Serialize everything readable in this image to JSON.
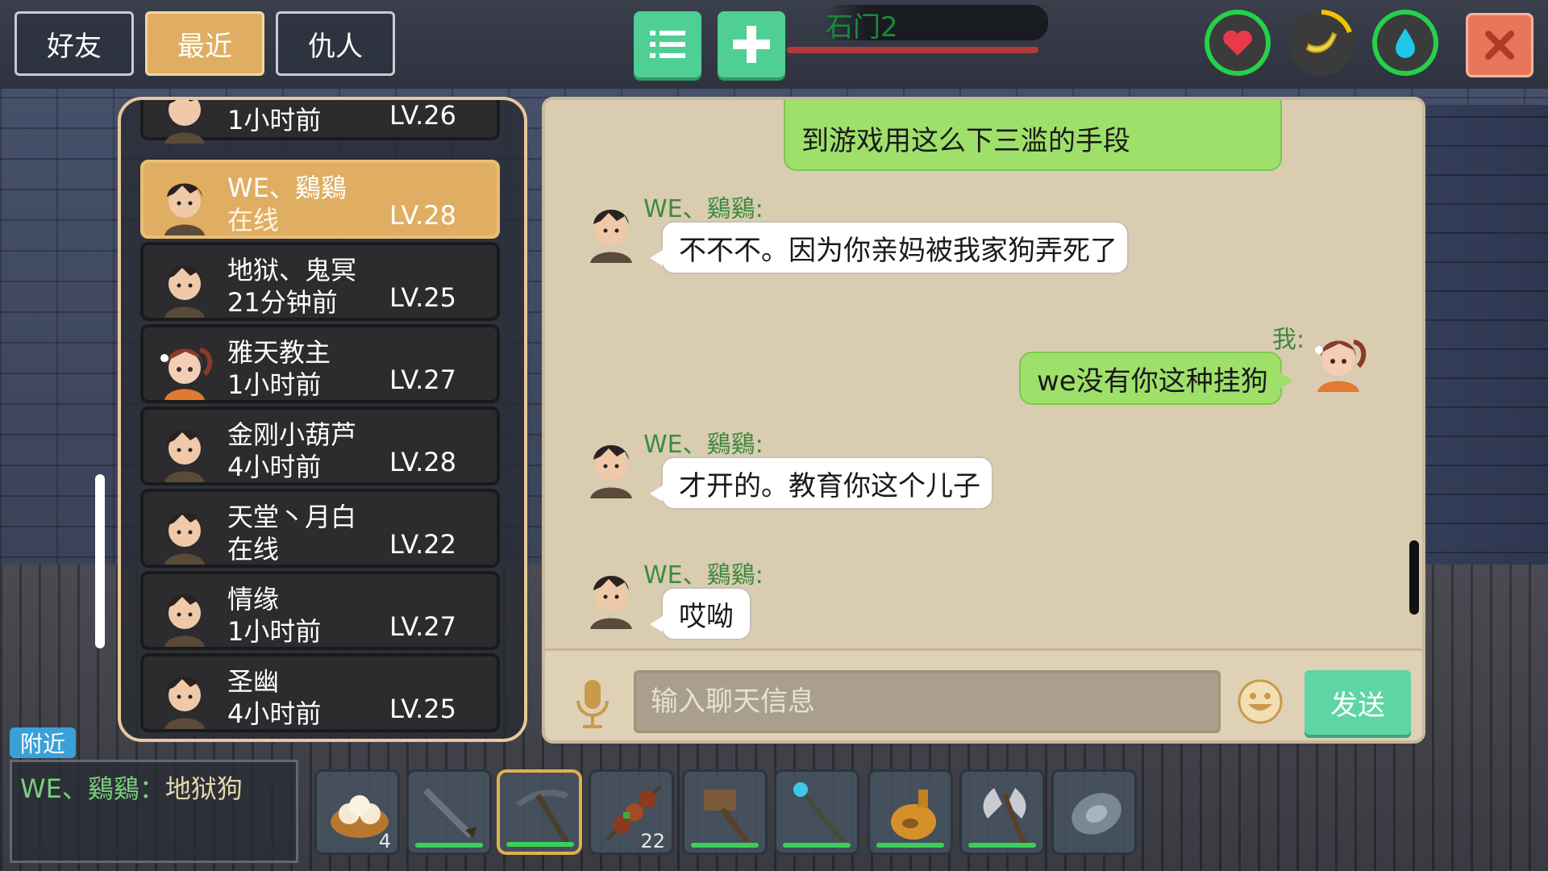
{
  "tabs": [
    {
      "label": "好友",
      "active": false
    },
    {
      "label": "最近",
      "active": true
    },
    {
      "label": "仇人",
      "active": false
    }
  ],
  "top": {
    "map_name": "石门2",
    "icons": [
      "list-icon",
      "plus-icon",
      "heart-icon",
      "banana-icon",
      "water-drop-icon",
      "close-icon"
    ]
  },
  "friends": [
    {
      "name": "",
      "status": "1小时前",
      "level": "LV.26",
      "avatar": "boy"
    },
    {
      "name": "WE、鷄鷄",
      "status": "在线",
      "level": "LV.28",
      "avatar": "boy",
      "active": true
    },
    {
      "name": "地狱、鬼冥",
      "status": "21分钟前",
      "level": "LV.25",
      "avatar": "boy"
    },
    {
      "name": "雅天教主",
      "status": "1小时前",
      "level": "LV.27",
      "avatar": "girl"
    },
    {
      "name": "金刚小葫芦",
      "status": "4小时前",
      "level": "LV.28",
      "avatar": "boy"
    },
    {
      "name": "天堂丶月白",
      "status": "在线",
      "level": "LV.22",
      "avatar": "boy"
    },
    {
      "name": "情缘",
      "status": "1小时前",
      "level": "LV.27",
      "avatar": "boy"
    },
    {
      "name": "圣幽",
      "status": "4小时前",
      "level": "LV.25",
      "avatar": "boy"
    }
  ],
  "chat": {
    "messages": [
      {
        "sender": "",
        "text": "到游戏用这么下三滥的手段",
        "mine": true
      },
      {
        "sender": "WE、鷄鷄:",
        "text": "不不不。因为你亲妈被我家狗弄死了",
        "mine": false
      },
      {
        "sender": "我:",
        "text": "we没有你这种挂狗",
        "mine": true
      },
      {
        "sender": "WE、鷄鷄:",
        "text": "才开的。教育你这个儿子",
        "mine": false
      },
      {
        "sender": "WE、鷄鷄:",
        "text": "哎呦",
        "mine": false
      }
    ],
    "input_placeholder": "输入聊天信息",
    "send_label": "发送"
  },
  "nearby": {
    "tag": "附近",
    "speaker": "WE、鷄鷄",
    "separator": "：",
    "message": "地狱狗"
  },
  "hotbar": [
    {
      "item": "steamed-buns-icon",
      "count": "4"
    },
    {
      "item": "sword-icon",
      "count": ""
    },
    {
      "item": "pickaxe-icon",
      "count": "",
      "selected": true
    },
    {
      "item": "kebab-icon",
      "count": "22"
    },
    {
      "item": "hammer-icon",
      "count": ""
    },
    {
      "item": "magic-staff-icon",
      "count": ""
    },
    {
      "item": "gourd-flask-icon",
      "count": ""
    },
    {
      "item": "battle-axe-icon",
      "count": ""
    },
    {
      "item": "shield-icon",
      "count": ""
    }
  ],
  "colors": {
    "tab_active": "#dfae62",
    "accent_green": "#4fcf94",
    "chat_bg": "#d9ccb1",
    "bubble_mine": "#9fe06a",
    "bubble_other": "#ffffff",
    "sender_name": "#3d8a3d",
    "close_button": "#e7765a"
  }
}
